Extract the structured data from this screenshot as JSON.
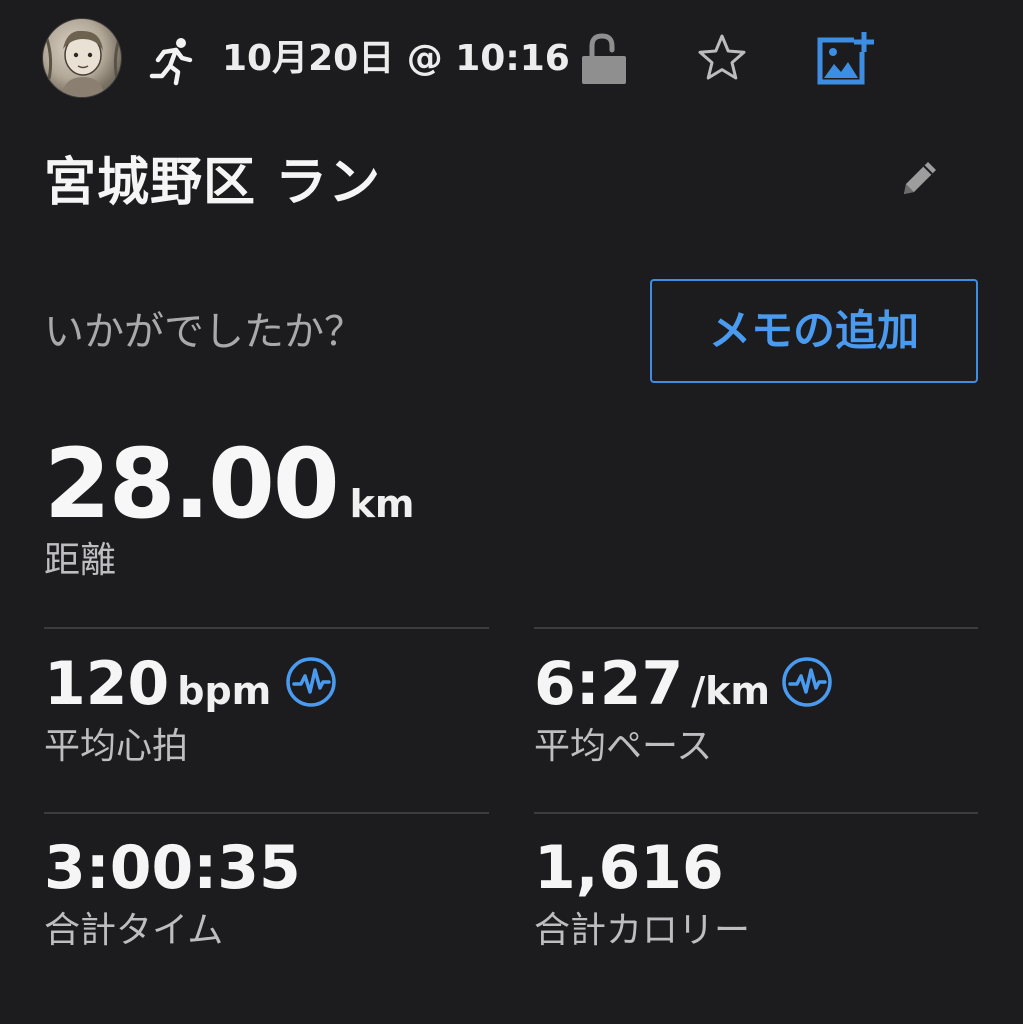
{
  "header": {
    "date_time": "10月20日 @ 10:16",
    "icons": {
      "avatar": "user-avatar",
      "activity_type": "running-icon",
      "privacy": "unlock-icon",
      "favorite": "star-icon",
      "add_photo": "add-photo-icon"
    }
  },
  "activity": {
    "title": "宮城野区 ラン",
    "edit_icon": "pencil-icon"
  },
  "memo": {
    "prompt": "いかがでしたか？",
    "add_button_label": "メモの追加"
  },
  "distance": {
    "value": "28.00",
    "unit": "km",
    "label": "距離"
  },
  "stats": {
    "avg_hr": {
      "value": "120",
      "unit": "bpm",
      "label": "平均心拍",
      "icon": "heart-rate-icon"
    },
    "avg_pace": {
      "value": "6:27",
      "unit": "/km",
      "label": "平均ペース",
      "icon": "pace-graph-icon"
    },
    "total_time": {
      "value": "3:00:35",
      "label": "合計タイム"
    },
    "total_calories": {
      "value": "1,616",
      "label": "合計カロリー"
    }
  },
  "colors": {
    "background": "#1c1c1e",
    "accent": "#3d8ee3",
    "text_primary": "#f5f5f5",
    "text_secondary": "#a9a9ad",
    "divider": "#3c3c40",
    "icon_gray": "#9a9a9a"
  }
}
